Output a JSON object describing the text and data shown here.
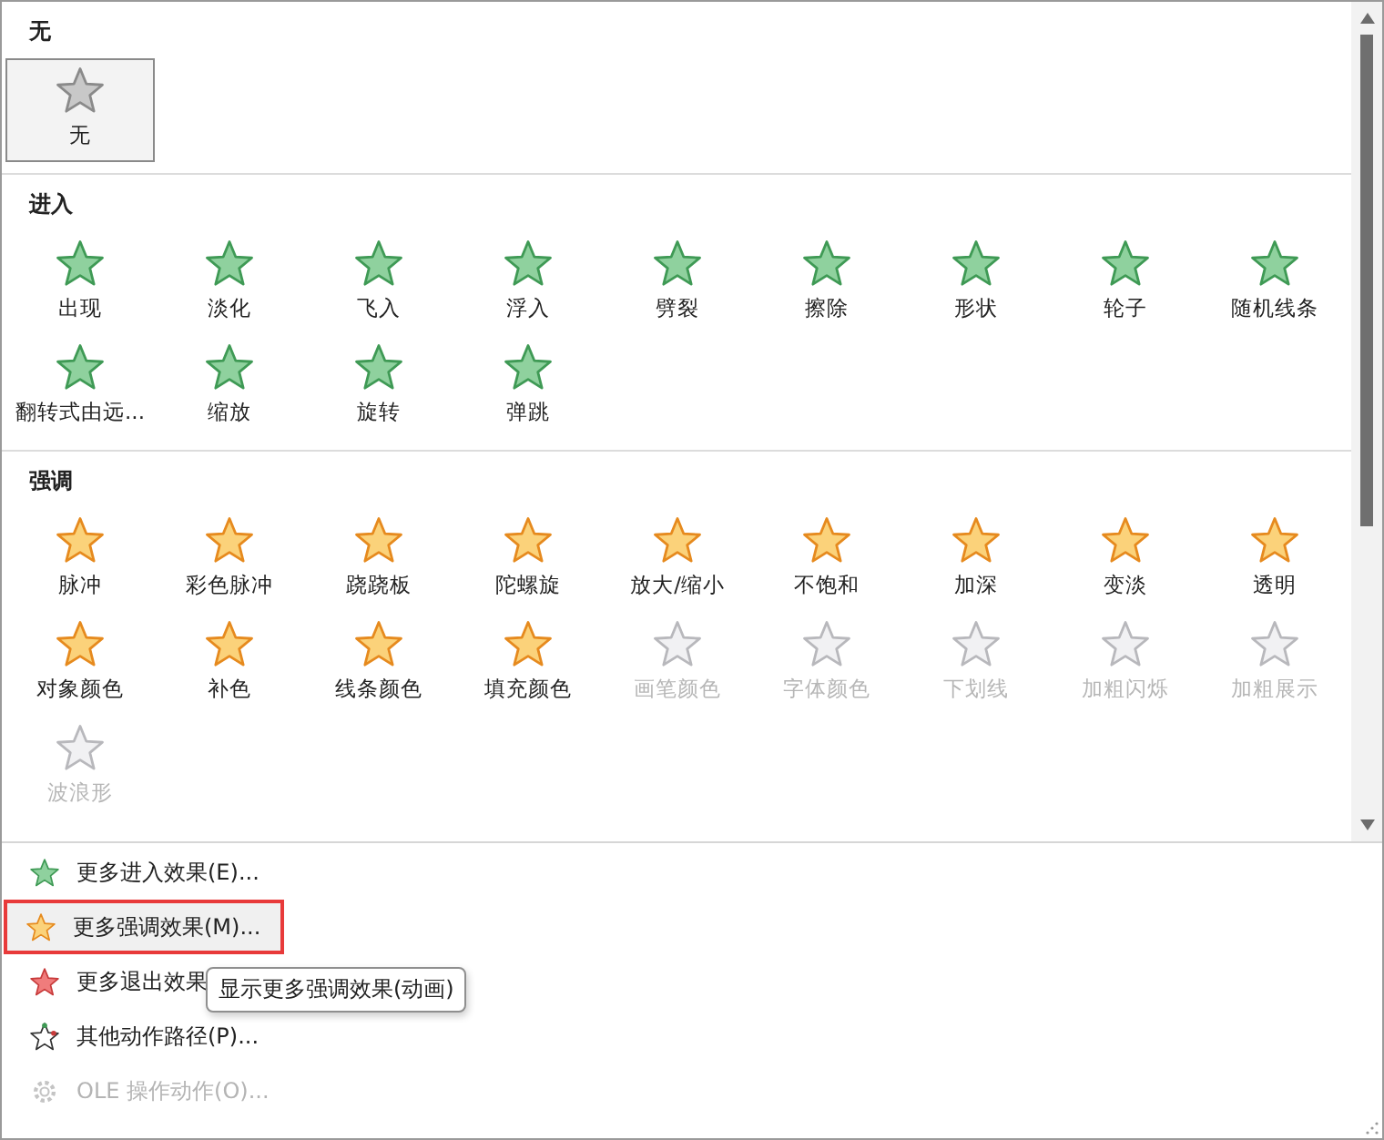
{
  "sections": [
    {
      "title": "无",
      "kind": "none",
      "items": [
        {
          "label": "无",
          "selected": true,
          "disabled": false
        }
      ]
    },
    {
      "title": "进入",
      "kind": "entrance",
      "items": [
        {
          "label": "出现",
          "selected": false,
          "disabled": false
        },
        {
          "label": "淡化",
          "selected": false,
          "disabled": false
        },
        {
          "label": "飞入",
          "selected": false,
          "disabled": false
        },
        {
          "label": "浮入",
          "selected": false,
          "disabled": false
        },
        {
          "label": "劈裂",
          "selected": false,
          "disabled": false
        },
        {
          "label": "擦除",
          "selected": false,
          "disabled": false
        },
        {
          "label": "形状",
          "selected": false,
          "disabled": false
        },
        {
          "label": "轮子",
          "selected": false,
          "disabled": false
        },
        {
          "label": "随机线条",
          "selected": false,
          "disabled": false
        },
        {
          "label": "翻转式由远...",
          "selected": false,
          "disabled": false
        },
        {
          "label": "缩放",
          "selected": false,
          "disabled": false
        },
        {
          "label": "旋转",
          "selected": false,
          "disabled": false
        },
        {
          "label": "弹跳",
          "selected": false,
          "disabled": false
        }
      ]
    },
    {
      "title": "强调",
      "kind": "emphasis",
      "items": [
        {
          "label": "脉冲",
          "selected": false,
          "disabled": false
        },
        {
          "label": "彩色脉冲",
          "selected": false,
          "disabled": false
        },
        {
          "label": "跷跷板",
          "selected": false,
          "disabled": false
        },
        {
          "label": "陀螺旋",
          "selected": false,
          "disabled": false
        },
        {
          "label": "放大/缩小",
          "selected": false,
          "disabled": false
        },
        {
          "label": "不饱和",
          "selected": false,
          "disabled": false
        },
        {
          "label": "加深",
          "selected": false,
          "disabled": false
        },
        {
          "label": "变淡",
          "selected": false,
          "disabled": false
        },
        {
          "label": "透明",
          "selected": false,
          "disabled": false
        },
        {
          "label": "对象颜色",
          "selected": false,
          "disabled": false
        },
        {
          "label": "补色",
          "selected": false,
          "disabled": false
        },
        {
          "label": "线条颜色",
          "selected": false,
          "disabled": false
        },
        {
          "label": "填充颜色",
          "selected": false,
          "disabled": false
        },
        {
          "label": "画笔颜色",
          "selected": false,
          "disabled": true
        },
        {
          "label": "字体颜色",
          "selected": false,
          "disabled": true
        },
        {
          "label": "下划线",
          "selected": false,
          "disabled": true
        },
        {
          "label": "加粗闪烁",
          "selected": false,
          "disabled": true
        },
        {
          "label": "加粗展示",
          "selected": false,
          "disabled": true
        },
        {
          "label": "波浪形",
          "selected": false,
          "disabled": true
        }
      ]
    }
  ],
  "menu": [
    {
      "kind": "entrance",
      "label": "更多进入效果(E)...",
      "selected": false,
      "marked": false,
      "disabled": false
    },
    {
      "kind": "emphasis",
      "label": "更多强调效果(M)...",
      "selected": true,
      "marked": true,
      "disabled": false
    },
    {
      "kind": "exit",
      "label": "更多退出效果",
      "selected": false,
      "marked": false,
      "disabled": false
    },
    {
      "kind": "path",
      "label": "其他动作路径(P)...",
      "selected": false,
      "marked": false,
      "disabled": false
    },
    {
      "kind": "ole",
      "label": "OLE 操作动作(O)...",
      "selected": false,
      "marked": false,
      "disabled": true
    }
  ],
  "tooltip": "显示更多强调效果(动画)"
}
